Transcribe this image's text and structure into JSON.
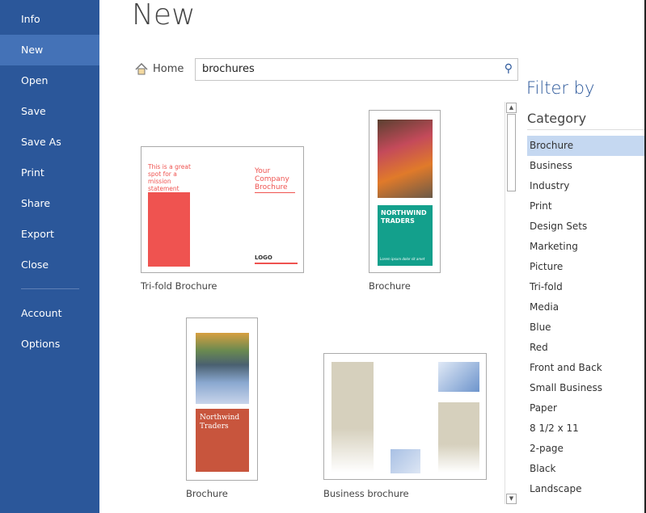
{
  "sidebar": {
    "items": [
      {
        "label": "Info"
      },
      {
        "label": "New",
        "active": true
      },
      {
        "label": "Open"
      },
      {
        "label": "Save"
      },
      {
        "label": "Save As"
      },
      {
        "label": "Print"
      },
      {
        "label": "Share"
      },
      {
        "label": "Export"
      },
      {
        "label": "Close"
      },
      {
        "label": "Account"
      },
      {
        "label": "Options"
      }
    ]
  },
  "header": {
    "title": "New",
    "home_label": "Home",
    "home_icon": "house-icon",
    "search_value": "brochures",
    "search_icon": "magnifier-icon"
  },
  "templates": [
    {
      "caption": "Tri-fold Brochure",
      "thumb": {
        "mission": "This is a great spot for a mission statement",
        "company": "Your Company Brochure",
        "logo": "LOGO"
      }
    },
    {
      "caption": "Brochure",
      "thumb": {
        "name": "NORTHWIND TRADERS",
        "tagline": "Lorem ipsum dolor sit amet"
      }
    },
    {
      "caption": "Brochure",
      "thumb": {
        "name": "Northwind Traders"
      }
    },
    {
      "caption": "Business brochure",
      "thumb": {}
    }
  ],
  "filter": {
    "title": "Filter by",
    "category_label": "Category",
    "categories": [
      "Brochure",
      "Business",
      "Industry",
      "Print",
      "Design Sets",
      "Marketing",
      "Picture",
      "Tri-fold",
      "Media",
      "Blue",
      "Red",
      "Front and Back",
      "Small Business",
      "Paper",
      "8 1/2 x 11",
      "2-page",
      "Black",
      "Landscape"
    ],
    "selected": "Brochure"
  },
  "colors": {
    "sidebar": "#2b579a",
    "accent_red": "#ef5350",
    "teal": "#13a08c",
    "rust": "#c8553d"
  }
}
